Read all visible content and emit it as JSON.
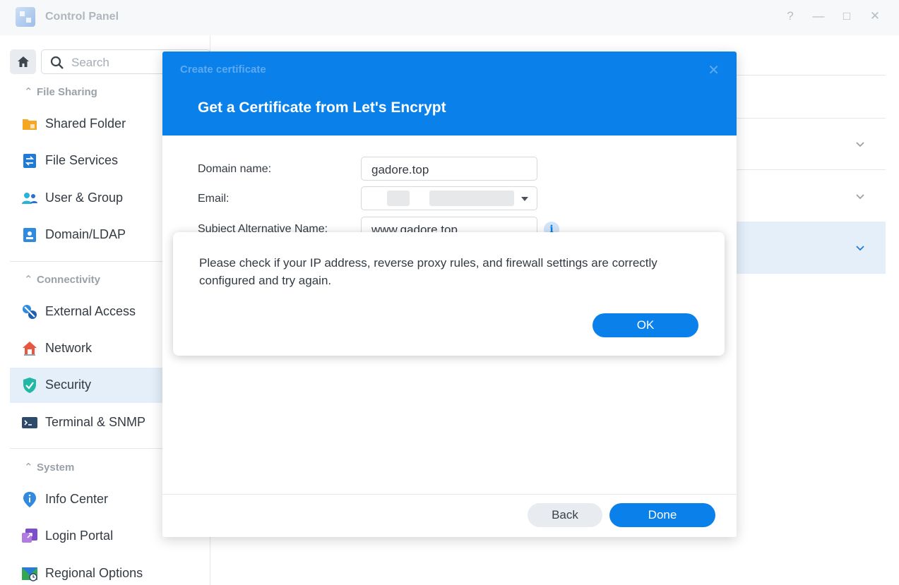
{
  "window": {
    "title": "Control Panel",
    "controls": {
      "help": "?",
      "minimize": "—",
      "maximize": "□",
      "close": "✕"
    }
  },
  "search": {
    "placeholder": "Search"
  },
  "sidebar": {
    "sections": [
      {
        "label": "File Sharing",
        "items": [
          {
            "label": "Shared Folder",
            "icon": "folder-icon"
          },
          {
            "label": "File Services",
            "icon": "file-services-icon"
          },
          {
            "label": "User & Group",
            "icon": "user-group-icon"
          },
          {
            "label": "Domain/LDAP",
            "icon": "domain-ldap-icon"
          }
        ]
      },
      {
        "label": "Connectivity",
        "items": [
          {
            "label": "External Access",
            "icon": "external-access-icon"
          },
          {
            "label": "Network",
            "icon": "network-icon"
          },
          {
            "label": "Security",
            "icon": "shield-icon",
            "active": true
          },
          {
            "label": "Terminal & SNMP",
            "icon": "terminal-icon"
          }
        ]
      },
      {
        "label": "System",
        "items": [
          {
            "label": "Info Center",
            "icon": "info-center-icon"
          },
          {
            "label": "Login Portal",
            "icon": "login-portal-icon"
          },
          {
            "label": "Regional Options",
            "icon": "regional-options-icon"
          }
        ]
      }
    ]
  },
  "dialog": {
    "subtitle": "Create certificate",
    "close": "✕",
    "title": "Get a Certificate from Let's Encrypt",
    "fields": {
      "domain_label": "Domain name:",
      "domain_value": "gadore.top",
      "email_label": "Email:",
      "san_label": "Subject Alternative Name:",
      "san_value": "www.gadore.top"
    },
    "info_glyph": "i",
    "back_label": "Back",
    "done_label": "Done"
  },
  "alert": {
    "message": "Please check if your IP address, reverse proxy rules, and firewall settings are correctly configured and try again.",
    "ok_label": "OK"
  },
  "colors": {
    "accent": "#0a80ea",
    "active_bg": "#e4effa"
  }
}
